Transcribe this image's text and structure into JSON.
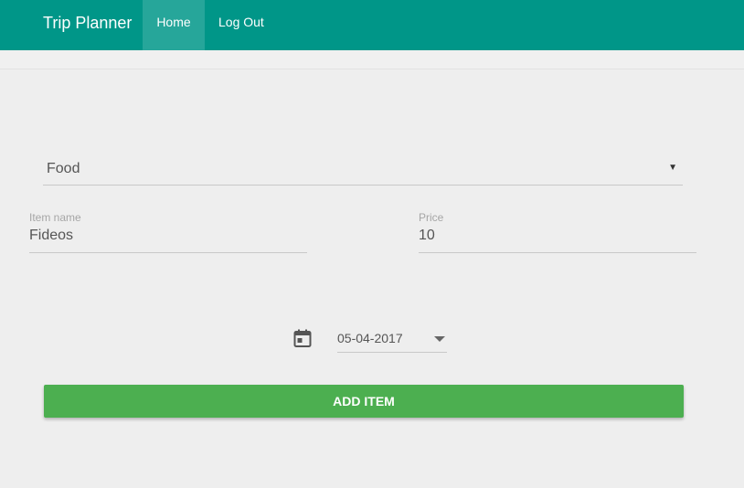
{
  "navbar": {
    "brand": "Trip Planner",
    "items": [
      {
        "label": "Home",
        "active": true
      },
      {
        "label": "Log Out",
        "active": false
      }
    ],
    "color": "#009688",
    "active_color": "#26a69a"
  },
  "form": {
    "category_select": {
      "selected": "Food"
    },
    "item_name": {
      "label": "Item name",
      "value": "Fideos"
    },
    "price": {
      "label": "Price",
      "value": "10"
    },
    "date": {
      "value": "05-04-2017",
      "icon": "calendar-icon"
    },
    "submit_label": "ADD ITEM",
    "submit_color": "#4caf50"
  }
}
